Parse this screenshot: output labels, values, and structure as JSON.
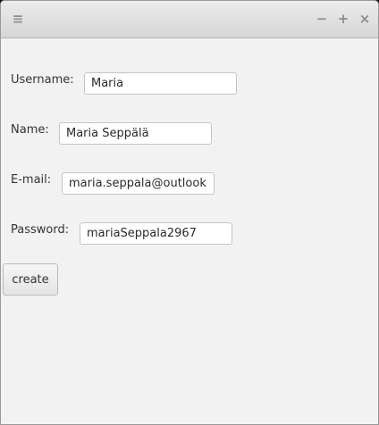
{
  "window": {
    "controls": {
      "menu_icon": "hamburger-menu-icon",
      "minimize_icon": "minimize-icon",
      "maximize_icon": "maximize-icon",
      "close_icon": "close-icon"
    }
  },
  "form": {
    "username": {
      "label": "Username:",
      "value": "Maria"
    },
    "name": {
      "label": "Name:",
      "value": "Maria Seppälä"
    },
    "email": {
      "label": "E-mail:",
      "value": "maria.seppala@outlook"
    },
    "password": {
      "label": "Password:",
      "value": "mariaSeppala2967"
    },
    "create_label": "create"
  }
}
